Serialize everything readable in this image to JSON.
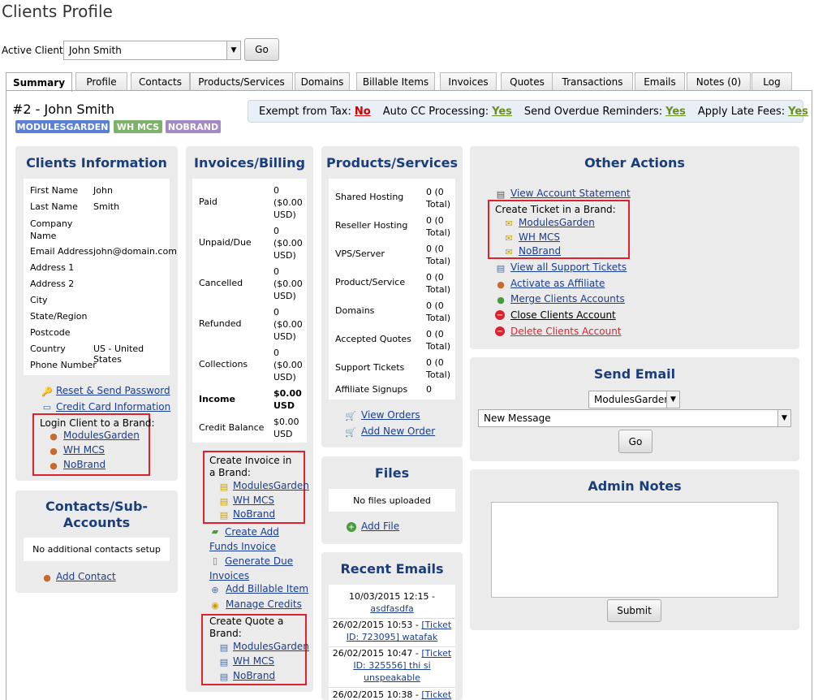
{
  "page": {
    "title": "Clients Profile"
  },
  "active_client": {
    "label": "Active Client:",
    "value": "John Smith",
    "go": "Go"
  },
  "tabs": [
    "Summary",
    "Profile",
    "Contacts",
    "Products/Services",
    "Domains",
    "Billable Items",
    "Invoices",
    "Quotes",
    "Transactions",
    "Emails",
    "Notes (0)",
    "Log"
  ],
  "client": {
    "name": "#2 - John Smith",
    "badges": [
      "MODULESGARDEN",
      "WH MCS",
      "NOBRAND"
    ]
  },
  "taxbar": {
    "exempt_label": "Exempt from Tax:",
    "exempt_value": "No",
    "autocc_label": "Auto CC Processing:",
    "autocc_value": "Yes",
    "overdue_label": "Send Overdue Reminders:",
    "overdue_value": "Yes",
    "late_label": "Apply Late Fees:",
    "late_value": "Yes"
  },
  "clients_info": {
    "title": "Clients Information",
    "fields": [
      {
        "label": "First Name",
        "value": "John"
      },
      {
        "label": "Last Name",
        "value": "Smith"
      },
      {
        "label": "Company Name",
        "value": ""
      },
      {
        "label": "Email Address",
        "value": "john@domain.com"
      },
      {
        "label": "Address 1",
        "value": ""
      },
      {
        "label": "Address 2",
        "value": ""
      },
      {
        "label": "City",
        "value": ""
      },
      {
        "label": "State/Region",
        "value": ""
      },
      {
        "label": "Postcode",
        "value": ""
      },
      {
        "label": "Country",
        "value": "US - United States"
      },
      {
        "label": "Phone Number",
        "value": ""
      }
    ],
    "reset": "Reset & Send Password",
    "credit_card": "Credit Card Information",
    "login_label": "Login Client to a Brand:",
    "brands": [
      "ModulesGarden",
      "WH MCS",
      "NoBrand"
    ]
  },
  "contacts": {
    "title": "Contacts/Sub-Accounts",
    "empty": "No additional contacts setup",
    "add": "Add Contact"
  },
  "invoices": {
    "title": "Invoices/Billing",
    "rows": [
      {
        "label": "Paid",
        "value": "0 ($0.00 USD)"
      },
      {
        "label": "Unpaid/Due",
        "value": "0 ($0.00 USD)"
      },
      {
        "label": "Cancelled",
        "value": "0 ($0.00 USD)"
      },
      {
        "label": "Refunded",
        "value": "0 ($0.00 USD)"
      },
      {
        "label": "Collections",
        "value": "0 ($0.00 USD)"
      },
      {
        "label": "Income",
        "value": "$0.00 USD"
      },
      {
        "label": "Credit Balance",
        "value": "$0.00 USD"
      }
    ],
    "create_invoice_label": "Create Invoice in a Brand:",
    "invoice_brands": [
      "ModulesGarden",
      "WH MCS",
      "NoBrand"
    ],
    "create_add_funds": "Create Add Funds Invoice",
    "generate_due": "Generate Due Invoices",
    "add_billable": "Add Billable Item",
    "manage_credits": "Manage Credits",
    "create_quote_label": "Create Quote a Brand:",
    "quote_brands": [
      "ModulesGarden",
      "WH MCS",
      "NoBrand"
    ]
  },
  "products": {
    "title": "Products/Services",
    "rows": [
      {
        "label": "Shared Hosting",
        "value": "0 (0 Total)"
      },
      {
        "label": "Reseller Hosting",
        "value": "0 (0 Total)"
      },
      {
        "label": "VPS/Server",
        "value": "0 (0 Total)"
      },
      {
        "label": "Product/Service",
        "value": "0 (0 Total)"
      },
      {
        "label": "Domains",
        "value": "0 (0 Total)"
      },
      {
        "label": "Accepted Quotes",
        "value": "0 (0 Total)"
      },
      {
        "label": "Support Tickets",
        "value": "0 (0 Total)"
      },
      {
        "label": "Affiliate Signups",
        "value": "0"
      }
    ],
    "view_orders": "View Orders",
    "add_order": "Add New Order"
  },
  "files": {
    "title": "Files",
    "empty": "No files uploaded",
    "add": "Add File"
  },
  "recent_emails": {
    "title": "Recent Emails",
    "items": [
      {
        "date": "10/03/2015 12:15 -",
        "subject": "asdfasdfa"
      },
      {
        "date": "26/02/2015 10:53 -",
        "subject": "[Ticket ID: 723095] watafak"
      },
      {
        "date": "26/02/2015 10:47 -",
        "subject": "[Ticket ID: 325556] thi si unspeakable"
      },
      {
        "date": "26/02/2015 10:38 -",
        "subject": "[Ticket"
      }
    ]
  },
  "other_actions": {
    "title": "Other Actions",
    "view_statement": "View Account Statement",
    "create_ticket_label": "Create Ticket in a Brand:",
    "ticket_brands": [
      "ModulesGarden",
      "WH MCS",
      "NoBrand"
    ],
    "view_tickets": "View all Support Tickets",
    "activate_affiliate": "Activate as Affiliate",
    "merge": "Merge Clients Accounts",
    "close": "Close Clients Account",
    "delete": "Delete Clients Account"
  },
  "send_email": {
    "title": "Send Email",
    "brand": "ModulesGarden",
    "template": "New Message",
    "go": "Go"
  },
  "admin_notes": {
    "title": "Admin Notes",
    "submit": "Submit"
  },
  "colors": {
    "badge_modulesgarden": "#5a7fd6",
    "badge_whmcs": "#7db26a",
    "badge_nobrand": "#a38ac4",
    "panel_title": "#1a3e7c",
    "highlight": "#d9232e"
  }
}
